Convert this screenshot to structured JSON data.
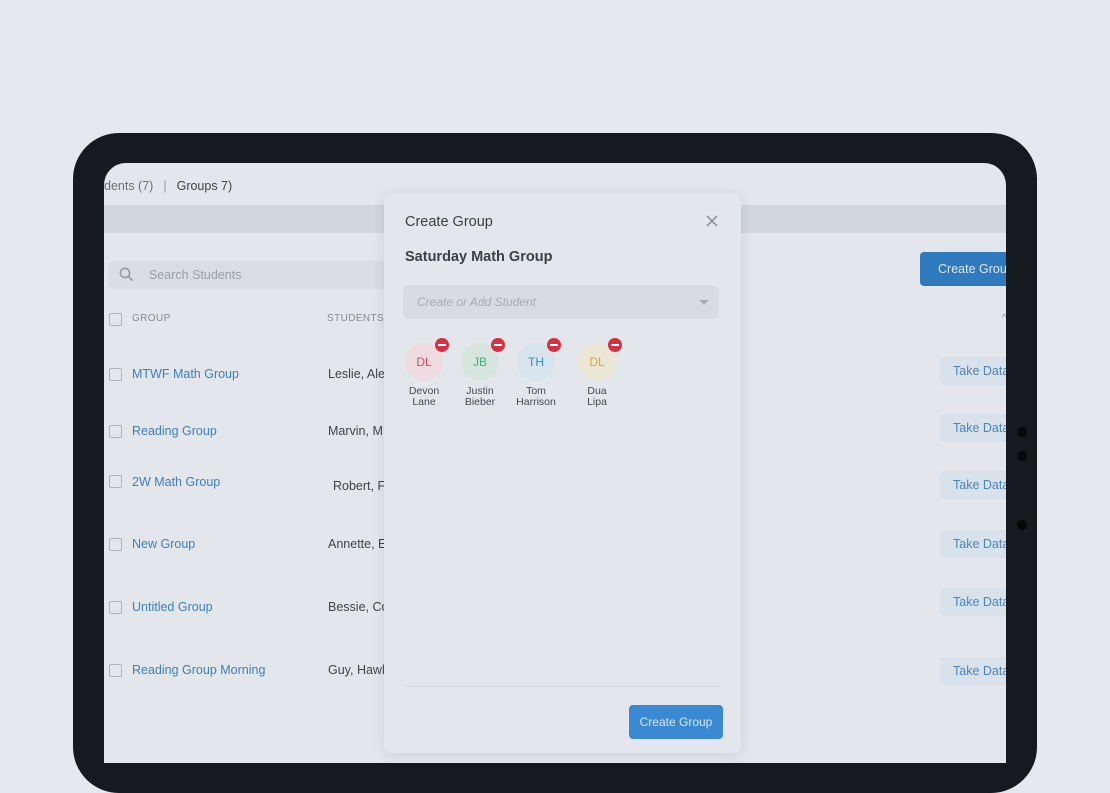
{
  "app": {
    "tabs": {
      "students": "dents (7)",
      "separator": "|",
      "groups": "Groups 7)"
    },
    "search": {
      "placeholder": "Search Students"
    },
    "create_group_button": "Create Group",
    "columns": {
      "group": "GROUP",
      "students": "STUDENTS"
    },
    "rows": [
      {
        "name": "MTWF Math Group",
        "students": "Leslie, Ale",
        "action": "Take Data"
      },
      {
        "name": "Reading Group",
        "students": "Marvin, M",
        "action": "Take Data"
      },
      {
        "name": "2W Math Group",
        "students": "Robert, F",
        "action": "Take Data"
      },
      {
        "name": "New Group",
        "students": "Annette, E",
        "action": "Take Data"
      },
      {
        "name": "Untitled Group",
        "students": "Bessie, Co",
        "action": "Take Data"
      },
      {
        "name": "Reading Group Morning",
        "students": "Guy, Hawk",
        "action": "Take Data"
      }
    ]
  },
  "modal": {
    "title": "Create Group",
    "group_name": "Saturday Math Group",
    "student_select_placeholder": "Create or Add Student",
    "students": [
      {
        "initials": "DL",
        "first": "Devon",
        "last": "Lane",
        "bg": "#eddbe0",
        "fg": "#d04a6c"
      },
      {
        "initials": "JB",
        "first": "Justin",
        "last": "Bieber",
        "bg": "#d6e6df",
        "fg": "#3fb07a"
      },
      {
        "initials": "TH",
        "first": "Tom",
        "last": "Harrison",
        "bg": "#d7e4ed",
        "fg": "#2e8fc6"
      },
      {
        "initials": "DL",
        "first": "Dua",
        "last": "Lipa",
        "bg": "#ebe6d6",
        "fg": "#d8a93a"
      }
    ],
    "submit_label": "Create Group"
  },
  "colors": {
    "accent": "#2f79bd",
    "remove": "#d83040"
  }
}
